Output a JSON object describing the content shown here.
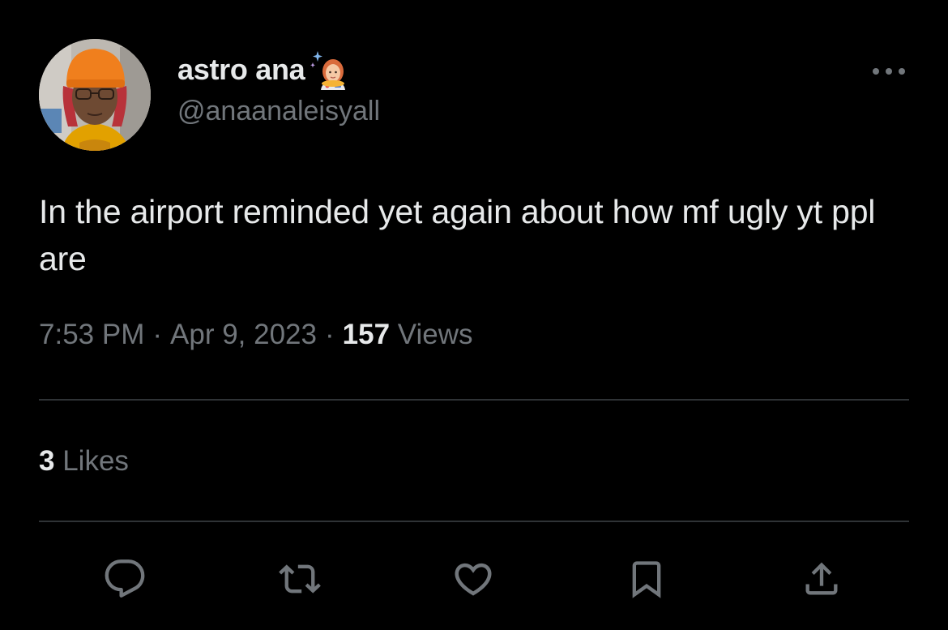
{
  "user": {
    "display_name": "astro ana",
    "name_emoji": "woman-astronaut-emoji",
    "handle": "@anaanaleisyall",
    "avatar": "profile-photo"
  },
  "tweet": {
    "text": "In the airport reminded yet again about how mf ugly yt ppl are",
    "time": "7:53 PM",
    "separator": "·",
    "date": "Apr 9, 2023",
    "views_count": "157",
    "views_label": "Views"
  },
  "stats": {
    "likes_count": "3",
    "likes_label": "Likes"
  },
  "actions": {
    "reply": "reply-icon",
    "retweet": "retweet-icon",
    "like": "heart-icon",
    "bookmark": "bookmark-icon",
    "share": "share-icon",
    "more": "more-icon"
  },
  "colors": {
    "background": "#000000",
    "primary_text": "#e7e9ea",
    "secondary_text": "#71767b",
    "divider": "#2f3336"
  }
}
